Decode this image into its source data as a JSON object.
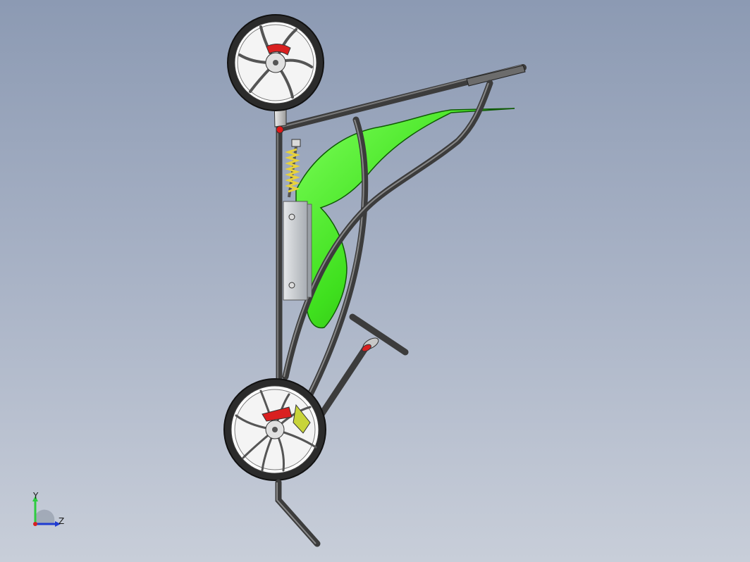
{
  "viewport": {
    "background_top": "#8c9ab3",
    "background_bottom": "#c8ced9"
  },
  "model": {
    "colors": {
      "frame_tube": "#3c3c3c",
      "fairing": "#3fe01e",
      "fairing_dark": "#1d8f0a",
      "spring": "#e8d23a",
      "brake_caliper": "#d92020",
      "tire": "#2b2b2b",
      "rim": "#e9e9e9",
      "plate": "#c9ccd0"
    }
  },
  "triad": {
    "y_label": "Y",
    "z_label": "Z",
    "y_color": "#2ecc40",
    "z_color": "#1f3bd1",
    "x_color": "#d62020"
  }
}
